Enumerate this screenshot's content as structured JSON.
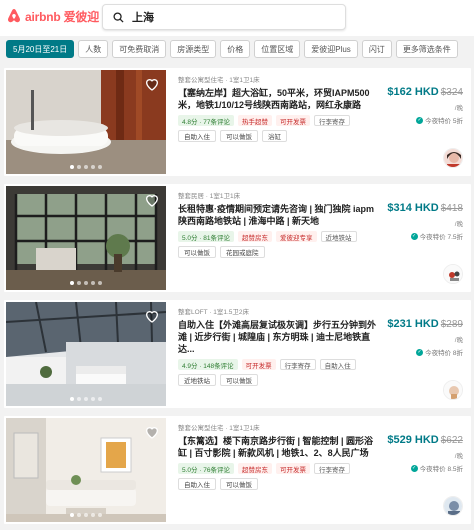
{
  "brand": {
    "logo_text": "airbnb 爱彼迎",
    "color": "#ff5a5f"
  },
  "search": {
    "query": "上海"
  },
  "filters": [
    "5月20日至21日",
    "人数",
    "可免费取消",
    "房源类型",
    "价格",
    "位置区域",
    "爱彼迎Plus",
    "闪订",
    "更多筛选条件"
  ],
  "accent": "#007a87",
  "listings": [
    {
      "subtitle": "整套公寓型住宅 · 1室1卫1床",
      "title": "【塞纳左岸】超大浴缸，50平米，环贸IAPM500米，地铁1/10/12号线陕西南路站，网红永康路",
      "badges": [
        "4.8分 · 77条评论",
        "热手超赞",
        "可开发票",
        "行李寄存"
      ],
      "tags": [
        "自助入住",
        "可以做饭",
        "浴缸"
      ],
      "price": "$162 HKD",
      "old_price": "$324",
      "per_night": "/晚",
      "discount": "今夜特价 5折"
    },
    {
      "subtitle": "整套民居 · 1室1卫1床",
      "title": "长租特惠·疫情期间预定请先咨询 | 独门独院 iapm陕西南路地铁站 | 淮海中路 | 新天地",
      "badges": [
        "5.0分 · 81条评论",
        "超赞房东",
        "爱彼迎专享",
        "近地铁站"
      ],
      "tags": [
        "可以做饭",
        "花园或庭院"
      ],
      "price": "$314 HKD",
      "old_price": "$418",
      "per_night": "/晚",
      "discount": "今夜特价 7.5折"
    },
    {
      "subtitle": "整套LOFT · 1室1.5卫2床",
      "title": "自助入住【外滩高层复试极灰调】步行五分钟到外滩 | 近步行街 | 城隍庙 | 东方明珠 | 迪士尼地铁直达...",
      "badges": [
        "4.9分 · 148条评论",
        "可开发票",
        "行李寄存",
        "自助入住"
      ],
      "tags": [
        "近地铁站",
        "可以做饭"
      ],
      "price": "$231 HKD",
      "old_price": "$289",
      "per_night": "/晚",
      "discount": "今夜特价 8折"
    },
    {
      "subtitle": "整套公寓型住宅 · 1室1卫1床",
      "title": "【东篱选】楼下南京路步行街 | 智能控制 | 圆形浴缸 | 百寸影院 | 新款风机 | 地铁1、2、8人民广场",
      "badges": [
        "5.0分 · 76条评论",
        "超赞房东",
        "可开发票",
        "行李寄存"
      ],
      "tags": [
        "自助入住",
        "可以做饭"
      ],
      "price": "$529 HKD",
      "old_price": "$622",
      "per_night": "/晚",
      "discount": "今夜特价 8.5折"
    }
  ]
}
